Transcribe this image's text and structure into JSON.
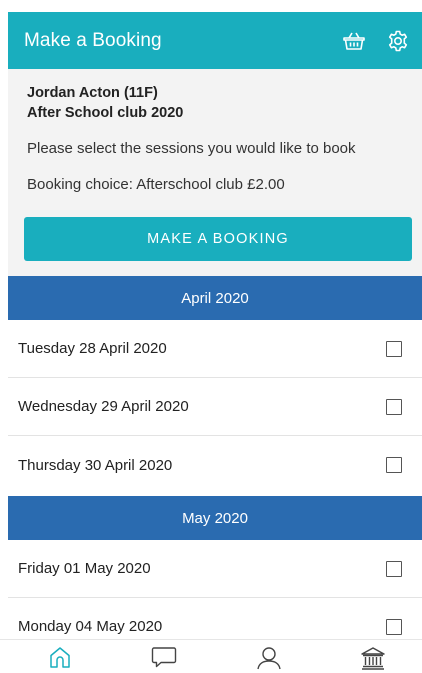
{
  "header": {
    "title": "Make a Booking",
    "basket_icon": "basket-icon",
    "settings_icon": "gear-icon"
  },
  "info": {
    "student": "Jordan Acton (11F)",
    "club": "After School club 2020",
    "prompt": "Please select the sessions you would like to book",
    "choice": "Booking choice: Afterschool club £2.00",
    "button_label": "MAKE A BOOKING"
  },
  "months": [
    {
      "label": "April 2020",
      "sessions": [
        {
          "label": "Tuesday 28 April 2020",
          "checked": false
        },
        {
          "label": "Wednesday 29 April 2020",
          "checked": false
        },
        {
          "label": "Thursday 30 April 2020",
          "checked": false
        }
      ]
    },
    {
      "label": "May 2020",
      "sessions": [
        {
          "label": "Friday 01 May 2020",
          "checked": false
        },
        {
          "label": "Monday 04 May 2020",
          "checked": false
        }
      ]
    }
  ],
  "bottom_nav": {
    "items": [
      {
        "icon": "home-icon",
        "active": true
      },
      {
        "icon": "chat-icon",
        "active": false
      },
      {
        "icon": "user-icon",
        "active": false
      },
      {
        "icon": "school-icon",
        "active": false
      }
    ]
  },
  "colors": {
    "accent": "#19aebe",
    "month_header": "#2a6bb0",
    "panel": "#f3f3f3"
  }
}
